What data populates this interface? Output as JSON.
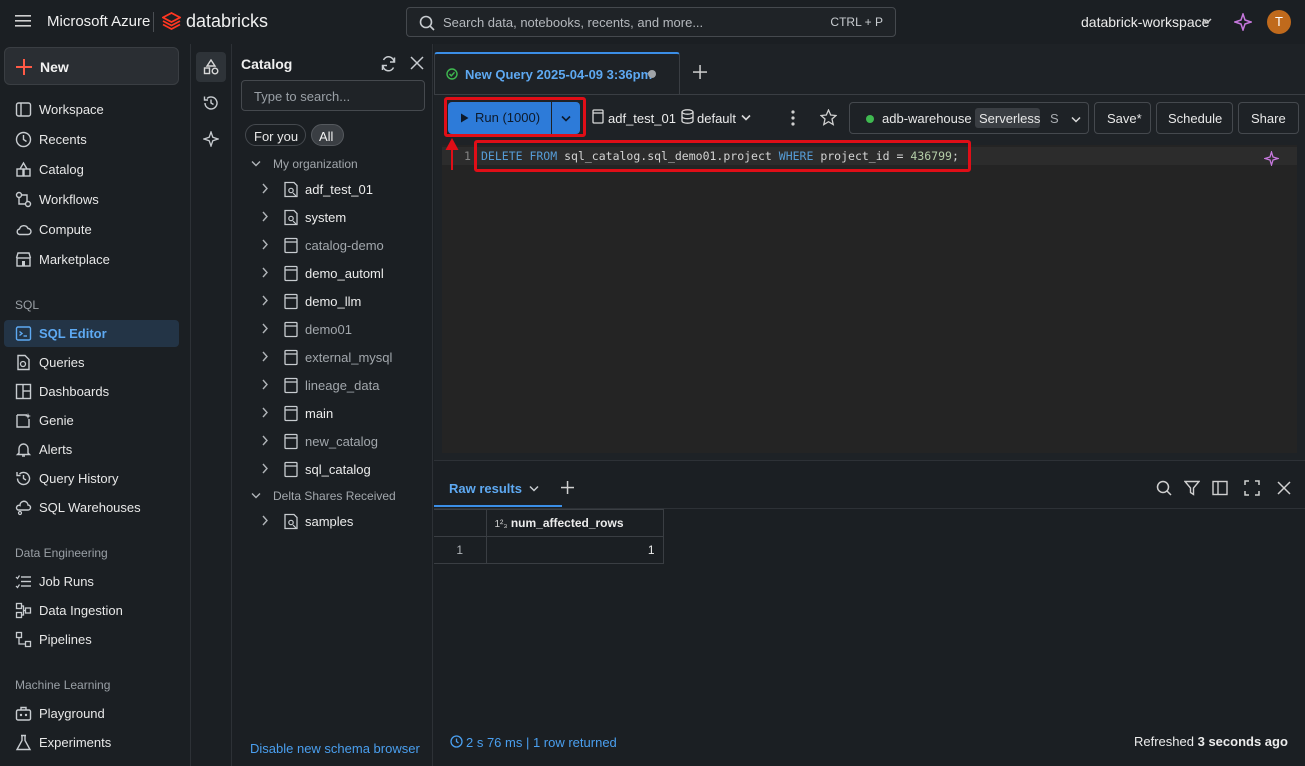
{
  "topbar": {
    "brand_azure": "Microsoft Azure",
    "brand_databricks": "databricks",
    "search_placeholder": "Search data, notebooks, recents, and more...",
    "search_shortcut": "CTRL + P",
    "workspace": "databrick-workspace",
    "avatar_initial": "T"
  },
  "sidebar": {
    "new_label": "New",
    "items": [
      {
        "label": "Workspace",
        "icon": "workspace-icon"
      },
      {
        "label": "Recents",
        "icon": "clock-icon"
      },
      {
        "label": "Catalog",
        "icon": "catalog-icon"
      },
      {
        "label": "Workflows",
        "icon": "workflows-icon"
      },
      {
        "label": "Compute",
        "icon": "cloud-icon"
      },
      {
        "label": "Marketplace",
        "icon": "store-icon"
      }
    ],
    "sql_header": "SQL",
    "sql_items": [
      {
        "label": "SQL Editor",
        "icon": "sql-editor-icon"
      },
      {
        "label": "Queries",
        "icon": "queries-icon"
      },
      {
        "label": "Dashboards",
        "icon": "dashboard-icon"
      },
      {
        "label": "Genie",
        "icon": "genie-icon"
      },
      {
        "label": "Alerts",
        "icon": "bell-icon"
      },
      {
        "label": "Query History",
        "icon": "history-icon"
      },
      {
        "label": "SQL Warehouses",
        "icon": "warehouse-icon"
      }
    ],
    "de_header": "Data Engineering",
    "de_items": [
      {
        "label": "Job Runs",
        "icon": "list-icon"
      },
      {
        "label": "Data Ingestion",
        "icon": "ingestion-icon"
      },
      {
        "label": "Pipelines",
        "icon": "pipeline-icon"
      }
    ],
    "ml_header": "Machine Learning",
    "ml_items": [
      {
        "label": "Playground",
        "icon": "playground-icon"
      },
      {
        "label": "Experiments",
        "icon": "flask-icon"
      }
    ]
  },
  "catalog": {
    "title": "Catalog",
    "search_placeholder": "Type to search...",
    "filter_for_you": "For you",
    "filter_all": "All",
    "org_header": "My organization",
    "items": [
      {
        "label": "adf_test_01",
        "bright": true
      },
      {
        "label": "system",
        "bright": true
      },
      {
        "label": "catalog-demo",
        "bright": false
      },
      {
        "label": "demo_automl",
        "bright": true
      },
      {
        "label": "demo_llm",
        "bright": true
      },
      {
        "label": "demo01",
        "bright": false
      },
      {
        "label": "external_mysql",
        "bright": false
      },
      {
        "label": "lineage_data",
        "bright": false
      },
      {
        "label": "main",
        "bright": true
      },
      {
        "label": "new_catalog",
        "bright": false
      },
      {
        "label": "sql_catalog",
        "bright": true
      }
    ],
    "shares_header": "Delta Shares Received",
    "shares_items": [
      {
        "label": "samples",
        "bright": true
      }
    ],
    "footer_link": "Disable new schema browser"
  },
  "editor": {
    "tab_title": "New Query 2025-04-09 3:36pm",
    "run_label": "Run (1000)",
    "catalog_select": "adf_test_01",
    "schema_select": "default",
    "warehouse": "adb-warehouse",
    "warehouse_type": "Serverless",
    "warehouse_size": "S",
    "save_label": "Save*",
    "schedule_label": "Schedule",
    "share_label": "Share",
    "line_number": "1",
    "code": {
      "kw1": "DELETE FROM",
      "table": "sql_catalog.sql_demo01.project",
      "kw2": "WHERE",
      "col": "project_id",
      "op": "=",
      "val": "436799",
      "end": ";"
    },
    "colors": {
      "accent": "#3b8ee6",
      "keyword": "#569cd6",
      "number": "#b5cea8",
      "highlight": "#e00e17"
    }
  },
  "results": {
    "tab_label": "Raw results",
    "column_type": "1²₃",
    "column_header": "num_affected_rows",
    "rows": [
      {
        "index": "1",
        "value": "1"
      }
    ],
    "timing": "2 s 76 ms | 1 row returned",
    "refreshed_prefix": "Refreshed",
    "refreshed_value": "3 seconds ago"
  }
}
